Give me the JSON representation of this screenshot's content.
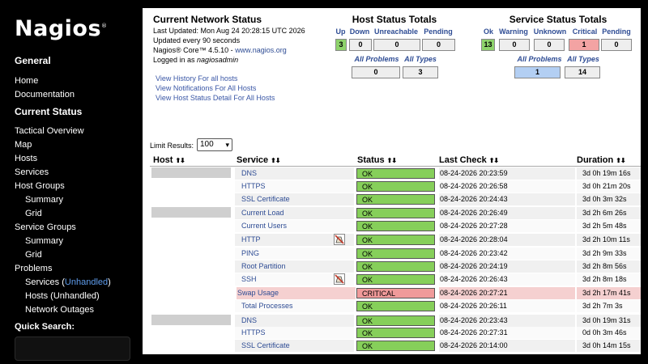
{
  "sidebar": {
    "logo": "Nagios",
    "logo_mark": "®",
    "general": "General",
    "home": "Home",
    "documentation": "Documentation",
    "current_status": "Current Status",
    "tactical_overview": "Tactical Overview",
    "map": "Map",
    "hosts": "Hosts",
    "services": "Services",
    "host_groups": "Host Groups",
    "hg_summary": "Summary",
    "hg_grid": "Grid",
    "service_groups": "Service Groups",
    "sg_summary": "Summary",
    "sg_grid": "Grid",
    "problems": "Problems",
    "prob_services": "Services (",
    "prob_services_hl": "Unhandled",
    "prob_services_end": ")",
    "prob_hosts": "Hosts (Unhandled)",
    "network_outages": "Network Outages",
    "quick_search": "Quick Search:"
  },
  "info": {
    "title": "Current Network Status",
    "last_updated": "Last Updated: Mon Aug 24 20:28:15 UTC 2026",
    "update_interval": "Updated every 90 seconds",
    "core_prefix": "Nagios® Core™ 4.5.10 - ",
    "core_link": "www.nagios.org",
    "logged_prefix": "Logged in as ",
    "logged_user": "nagiosadmin",
    "links": [
      "View History For all hosts",
      "View Notifications For All Hosts",
      "View Host Status Detail For All Hosts"
    ]
  },
  "host_totals": {
    "title": "Host Status Totals",
    "heads": [
      "Up",
      "Down",
      "Unreachable",
      "Pending"
    ],
    "values": [
      "3",
      "0",
      "0",
      "0"
    ],
    "all_problems": "All Problems",
    "all_types": "All Types",
    "problems_value": "0",
    "types_value": "3"
  },
  "service_totals": {
    "title": "Service Status Totals",
    "heads": [
      "Ok",
      "Warning",
      "Unknown",
      "Critical",
      "Pending"
    ],
    "values": [
      "13",
      "0",
      "0",
      "1",
      "0"
    ],
    "all_problems": "All Problems",
    "all_types": "All Types",
    "problems_value": "1",
    "types_value": "14"
  },
  "limit": {
    "label": "Limit Results:",
    "value": "100",
    "caret": "▾"
  },
  "columns": {
    "host": "Host",
    "service": "Service",
    "status": "Status",
    "last_check": "Last Check",
    "duration": "Duration",
    "sort": "⬆⬇"
  },
  "rows": [
    {
      "service": "DNS",
      "status": "OK",
      "last_check": "08-24-2026 20:23:59",
      "duration": "3d 0h 19m 16s"
    },
    {
      "service": "HTTPS",
      "status": "OK",
      "last_check": "08-24-2026 20:26:58",
      "duration": "3d 0h 21m 20s"
    },
    {
      "service": "SSL Certificate",
      "status": "OK",
      "last_check": "08-24-2026 20:24:43",
      "duration": "3d 0h 3m 32s"
    },
    {
      "service": "Current Load",
      "status": "OK",
      "last_check": "08-24-2026 20:26:49",
      "duration": "3d 2h 6m 26s"
    },
    {
      "service": "Current Users",
      "status": "OK",
      "last_check": "08-24-2026 20:27:28",
      "duration": "3d 2h 5m 48s"
    },
    {
      "service": "HTTP",
      "status": "OK",
      "last_check": "08-24-2026 20:28:04",
      "duration": "3d 2h 10m 11s"
    },
    {
      "service": "PING",
      "status": "OK",
      "last_check": "08-24-2026 20:23:42",
      "duration": "3d 2h 9m 33s"
    },
    {
      "service": "Root Partition",
      "status": "OK",
      "last_check": "08-24-2026 20:24:19",
      "duration": "3d 2h 8m 56s"
    },
    {
      "service": "SSH",
      "status": "OK",
      "last_check": "08-24-2026 20:26:43",
      "duration": "3d 2h 8m 18s"
    },
    {
      "service": "Swap Usage",
      "status": "CRITICAL",
      "last_check": "08-24-2026 20:27:21",
      "duration": "3d 2h 17m 41s"
    },
    {
      "service": "Total Processes",
      "status": "OK",
      "last_check": "08-24-2026 20:26:11",
      "duration": "3d 2h 7m 3s"
    },
    {
      "service": "DNS",
      "status": "OK",
      "last_check": "08-24-2026 20:23:43",
      "duration": "3d 0h 19m 31s"
    },
    {
      "service": "HTTPS",
      "status": "OK",
      "last_check": "08-24-2026 20:27:31",
      "duration": "0d 0h 3m 46s"
    },
    {
      "service": "SSL Certificate",
      "status": "OK",
      "last_check": "08-24-2026 20:14:00",
      "duration": "3d 0h 14m 15s"
    }
  ],
  "icons": {
    "notifications_disabled": "notifications-disabled-icon"
  },
  "colors": {
    "ok": "#86cf5a",
    "critical": "#f09a9a",
    "up": "#8ed36b",
    "link": "#2e4c94"
  }
}
